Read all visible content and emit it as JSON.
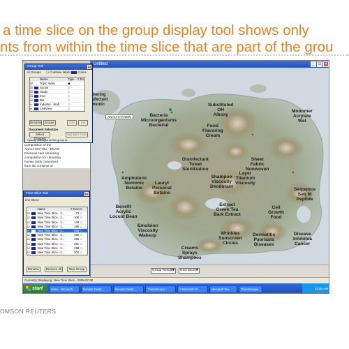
{
  "slide": {
    "line1": "a time slice on the group display tool shows only",
    "line2": "nts from within the time slice that are part of the grou",
    "footer": "OMSON REUTERS"
  },
  "main_window": {
    "title": "Untitled",
    "tooltip": "ANALYST/VIEW"
  },
  "map_labels": [
    {
      "id": "substituted-oh-alkoxy",
      "text": "Substituted\nOH\nAlkoxy"
    },
    {
      "id": "food-flavoring-cream",
      "text": "Food\nFlavoring\nCream"
    },
    {
      "id": "monomer-acrylate-wet",
      "text": "Monomer\nAcrylate\nWet"
    },
    {
      "id": "bacteria-microorganisms",
      "text": "Bacteria\nMicroorganisms\nBacterial"
    },
    {
      "id": "sheet-fabric-nonwoven",
      "text": "Sheet\nFabric\nNonwoven"
    },
    {
      "id": "disinfectant-towel",
      "text": "Disinfectant\nTowel\nSterilization"
    },
    {
      "id": "shampoo-viscosity",
      "text": "Shampoo\nViscosity\nDeodorant"
    },
    {
      "id": "layer-titanium",
      "text": "Layer\nTitanium\nViscosity"
    },
    {
      "id": "amphoteric-nonionic",
      "text": "Amphoteric\nNonionic\nBetaine"
    },
    {
      "id": "lauryl-personal",
      "text": "Lauryl\nPersonal\nBetaine"
    },
    {
      "id": "sequence-seq-id",
      "text": "Sequence\nSeq Id\nPeptide"
    },
    {
      "id": "benefit-acrylic",
      "text": "Benefit\nAcrylic\nLocust Bean"
    },
    {
      "id": "extract-green-tea",
      "text": "Extract\nGreen Tea\nBark Extract"
    },
    {
      "id": "cell-growth",
      "text": "Cell\nGrowth\nFood"
    },
    {
      "id": "emulsion-viscosity",
      "text": "Emulsion\nViscosity\nMakeup"
    },
    {
      "id": "wrinkles-sunscreen",
      "text": "Wrinkles\nSunscreen\nCircles"
    },
    {
      "id": "dermatitis-psoriasis",
      "text": "Dermatitis\nPsoriasis\nDiseases"
    },
    {
      "id": "disease-inhibitor",
      "text": "Disease\nInhibitor\nCancer"
    },
    {
      "id": "creams-sprays",
      "text": "Creams\nSprays\nShampoos"
    },
    {
      "id": "partial-left",
      "text": "thering\nnsfectant\nmonic"
    }
  ],
  "group_tool": {
    "title": "Group Tool",
    "checkbox_label": "Groups",
    "col_labels": "Combine labels",
    "colors_label": "Colors",
    "columns": [
      "Name",
      "Type",
      "# Do"
    ],
    "rows": [
      {
        "name": "Topic Index",
        "type": "",
        "docs": ""
      },
      {
        "name": "Social",
        "type": "",
        "docs": ""
      },
      {
        "name": "Study",
        "type": "",
        "docs": ""
      },
      {
        "name": "Eco",
        "type": "",
        "docs": ""
      },
      {
        "name": "Bio",
        "type": "",
        "docs": ""
      },
      {
        "name": "Industry - draft",
        "type": "",
        "docs": ""
      },
      {
        "name": "LinkView",
        "type": "",
        "docs": ""
      }
    ],
    "btn_rename": "Rename",
    "btn_groups": "Groups",
    "btn_edit": "Edit",
    "btn_del": "Del",
    "doc_selection": "Document Selection",
    "btn_select_grouped": "Select Grouped",
    "btn_highlight": "Highlight Tools",
    "opacity_text": "Opacity displayed on this group at"
  },
  "side_text": [
    "Composition of the",
    "ANALYSIS 'Title - ENAR'",
    "Personal care cleansing",
    "composition for cleansing",
    "human body comprised",
    "from the contents of"
  ],
  "time_slice": {
    "title": "Time Slice Tool",
    "subtitle": "ime Slices",
    "columns": [
      "Name",
      "# Docs",
      "C"
    ],
    "rows": [
      {
        "name": "New Time Slice - 2...",
        "docs": "73",
        "selected": false
      },
      {
        "name": "New Time Slice - 2...",
        "docs": "108",
        "selected": false
      },
      {
        "name": "New Time Slice - 2...",
        "docs": "149",
        "selected": false
      },
      {
        "name": "New Time Slice - 2...",
        "docs": "185",
        "selected": false
      },
      {
        "name": "New Time Slice - 2...",
        "docs": "294",
        "selected": true
      },
      {
        "name": "New Time Slice - 2...",
        "docs": "256",
        "selected": false
      },
      {
        "name": "New Time Slice - 2...",
        "docs": "255",
        "selected": false
      },
      {
        "name": "New Time Slice - 2...",
        "docs": "281",
        "selected": false
      },
      {
        "name": "New Time Slice - 2...",
        "docs": "298",
        "selected": false
      },
      {
        "name": "New Time Slice - 2...",
        "docs": "302",
        "selected": false
      }
    ],
    "btn_rename": "Rename",
    "btn_remove_all": "Remove All",
    "btn_new_group": "New Group"
  },
  "status_bar": {
    "dd1": "Group Results",
    "dd2": "New Slices",
    "text": "Currently Displaying: New Time Slice - 2008-07-08"
  },
  "taskbar": {
    "start": "start",
    "tasks": [
      "Inbox - Microsoft...",
      "Remote Deskt...",
      "Remote Deskt...",
      "ThemeScape...",
      "2 Microsoft Of...",
      "Microsoft Tea...",
      "ThemeScape..."
    ],
    "clock": "11:05 AM"
  },
  "colors": {
    "headline": "#e8831e",
    "title_bar": "#2452b9",
    "taskbar": "#1f4fb8",
    "selection": "#316ac5"
  }
}
